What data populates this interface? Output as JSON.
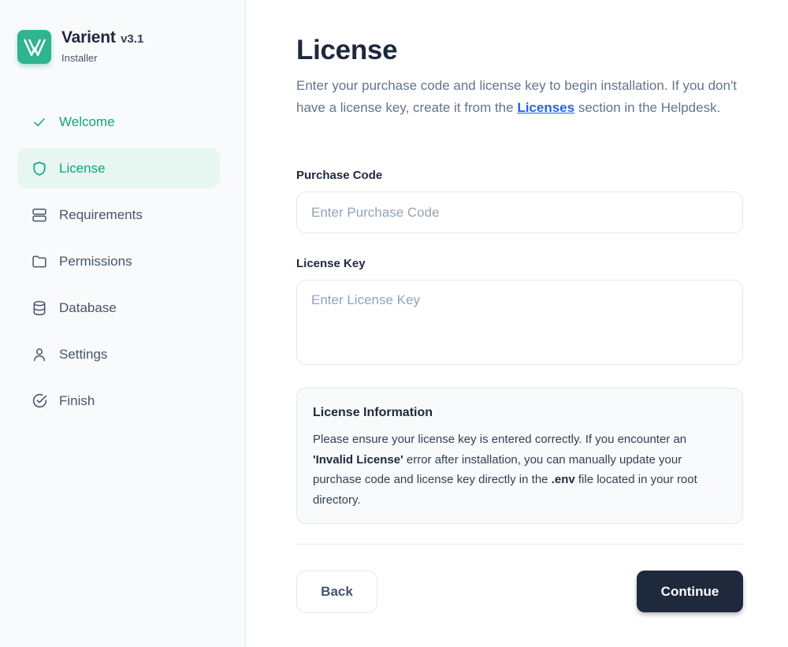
{
  "brand": {
    "name": "Varient",
    "version": "v3.1",
    "subtitle": "Installer",
    "accent": "#2fb391"
  },
  "sidebar": {
    "items": [
      {
        "label": "Welcome",
        "icon": "check-icon",
        "state": "done"
      },
      {
        "label": "License",
        "icon": "shield-icon",
        "state": "active"
      },
      {
        "label": "Requirements",
        "icon": "server-icon",
        "state": "pending"
      },
      {
        "label": "Permissions",
        "icon": "folder-icon",
        "state": "pending"
      },
      {
        "label": "Database",
        "icon": "database-icon",
        "state": "pending"
      },
      {
        "label": "Settings",
        "icon": "user-icon",
        "state": "pending"
      },
      {
        "label": "Finish",
        "icon": "check-circle-icon",
        "state": "pending"
      }
    ]
  },
  "page": {
    "title": "License",
    "intro_before": "Enter your purchase code and license key to begin installation. If you don't have a license key, create it from the ",
    "intro_link": "Licenses",
    "intro_after": " section in the Helpdesk."
  },
  "form": {
    "purchase_code_label": "Purchase Code",
    "purchase_code_placeholder": "Enter Purchase Code",
    "purchase_code_value": "",
    "license_key_label": "License Key",
    "license_key_placeholder": "Enter License Key",
    "license_key_value": ""
  },
  "info": {
    "title": "License Information",
    "part1": "Please ensure your license key is entered correctly. If you encounter an ",
    "bold1": "'Invalid License'",
    "part2": " error after installation, you can manually update your purchase code and license key directly in the ",
    "bold2": ".env",
    "part3": " file located in your root directory."
  },
  "actions": {
    "back_label": "Back",
    "continue_label": "Continue"
  }
}
